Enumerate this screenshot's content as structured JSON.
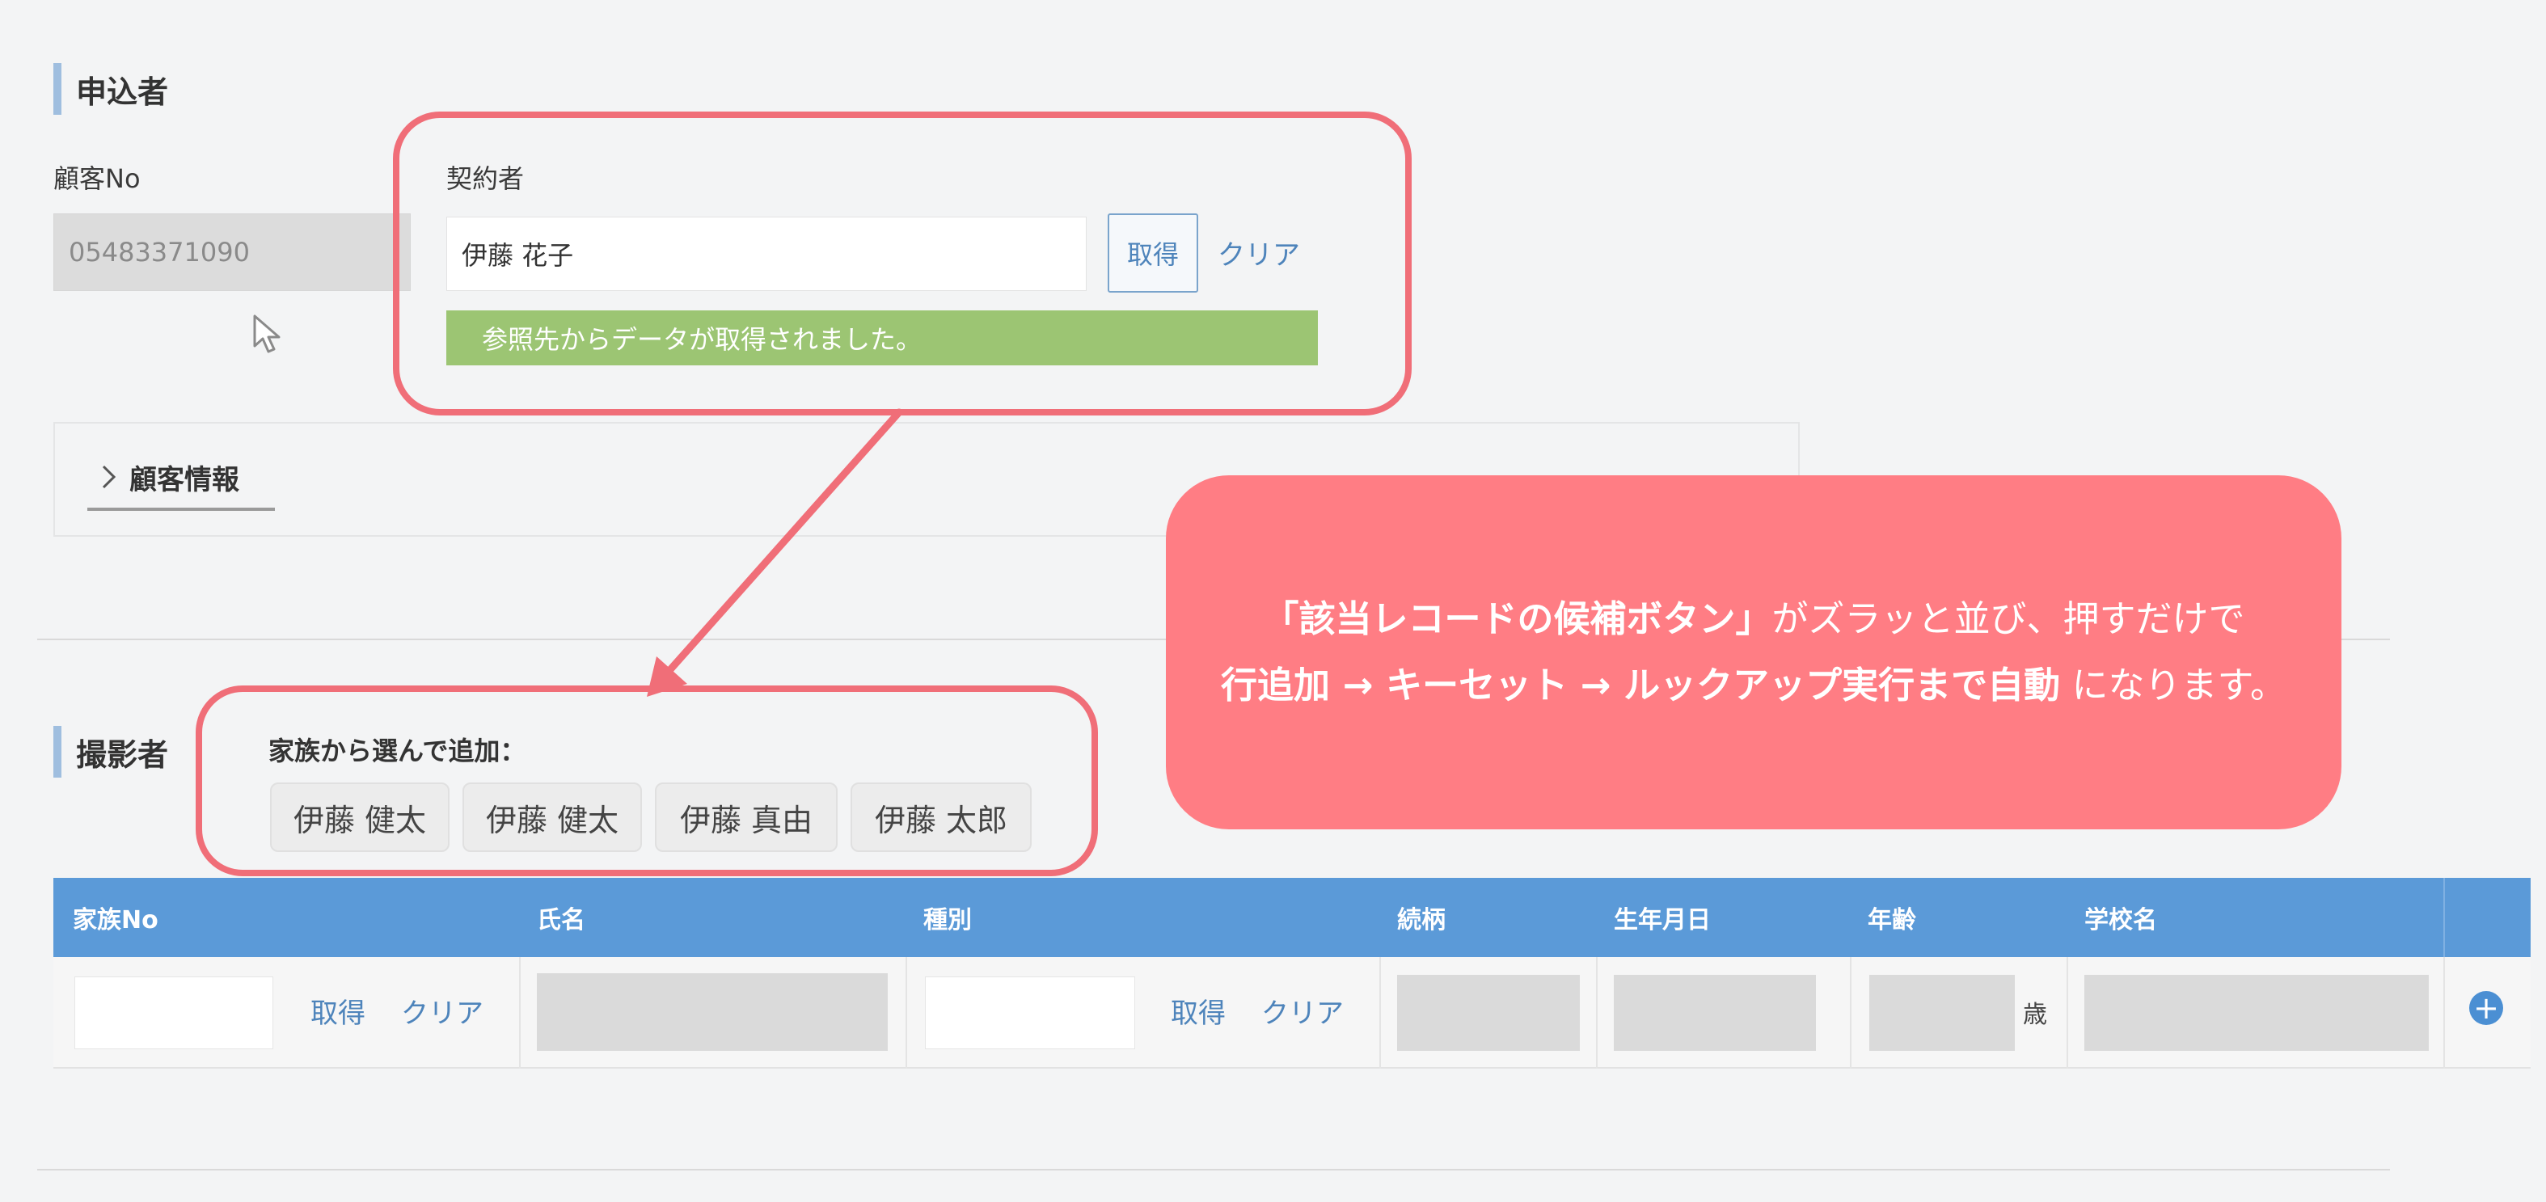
{
  "applicant": {
    "section_title": "申込者",
    "customer_no_label": "顧客No",
    "customer_no_value": "05483371090",
    "contractor_label": "契約者",
    "contractor_value": "伊藤 花子",
    "get_button": "取得",
    "clear_link": "クリア",
    "success_message": "参照先からデータが取得されました。",
    "accordion_label": "顧客情報"
  },
  "callout": {
    "line1_bold": "「該当レコードの候補ボタン」",
    "line1_rest": "がズラッと並び、押すだけで",
    "line2_bold": "行追加 → キーセット → ルックアップ実行まで自動",
    "line2_rest": "になります。",
    "color": "#ff7d84"
  },
  "photographer": {
    "section_title": "撮影者",
    "family_label": "家族から選んで追加：",
    "family_chips": [
      "伊藤 健太",
      "伊藤 健太",
      "伊藤 真由",
      "伊藤 太郎"
    ]
  },
  "table": {
    "headers": [
      "家族No",
      "氏名",
      "種別",
      "続柄",
      "生年月日",
      "年齢",
      "学校名"
    ],
    "row": {
      "get_label": "取得",
      "clear_label": "クリア",
      "age_unit": "歳"
    },
    "header_color": "#5b9ad8"
  },
  "icons": {
    "cursor": "mouse-pointer-icon",
    "chevron": "chevron-right-icon",
    "add": "plus-circle-icon"
  }
}
